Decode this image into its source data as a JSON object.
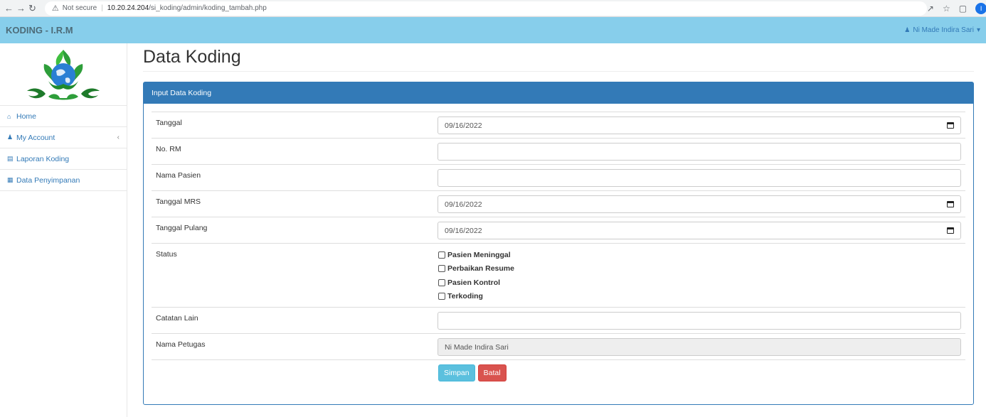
{
  "browser": {
    "security_label": "Not secure",
    "url_host": "10.20.24.204",
    "url_path": "/si_koding/admin/koding_tambah.php",
    "profile_initial": "I"
  },
  "navbar": {
    "brand": "KODING - I.R.M",
    "user_name": "Ni Made Indira Sari"
  },
  "sidebar": {
    "items": [
      {
        "label": "Home",
        "icon": "home-icon"
      },
      {
        "label": "My Account",
        "icon": "user-icon"
      },
      {
        "label": "Laporan Koding",
        "icon": "bar-chart-icon"
      },
      {
        "label": "Data Penyimpanan",
        "icon": "table-icon"
      }
    ]
  },
  "main": {
    "title": "Data Koding",
    "panel_title": "Input Data Koding",
    "fields": {
      "tanggal": {
        "label": "Tanggal",
        "value": "09/16/2022"
      },
      "no_rm": {
        "label": "No. RM",
        "value": ""
      },
      "nama_pasien": {
        "label": "Nama Pasien",
        "value": ""
      },
      "tanggal_mrs": {
        "label": "Tanggal MRS",
        "value": "09/16/2022"
      },
      "tanggal_pulang": {
        "label": "Tanggal Pulang",
        "value": "09/16/2022"
      },
      "status": {
        "label": "Status",
        "options": [
          "Pasien Meninggal",
          "Perbaikan Resume",
          "Pasien Kontrol",
          "Terkoding"
        ]
      },
      "catatan_lain": {
        "label": "Catatan Lain",
        "value": ""
      },
      "nama_petugas": {
        "label": "Nama Petugas",
        "value": "Ni Made Indira Sari"
      }
    },
    "buttons": {
      "save": "Simpan",
      "cancel": "Batal"
    }
  },
  "colors": {
    "navbar": "#87ceeb",
    "panel_primary": "#337ab7",
    "save_button": "#5bc0de",
    "cancel_button": "#d9534f"
  }
}
